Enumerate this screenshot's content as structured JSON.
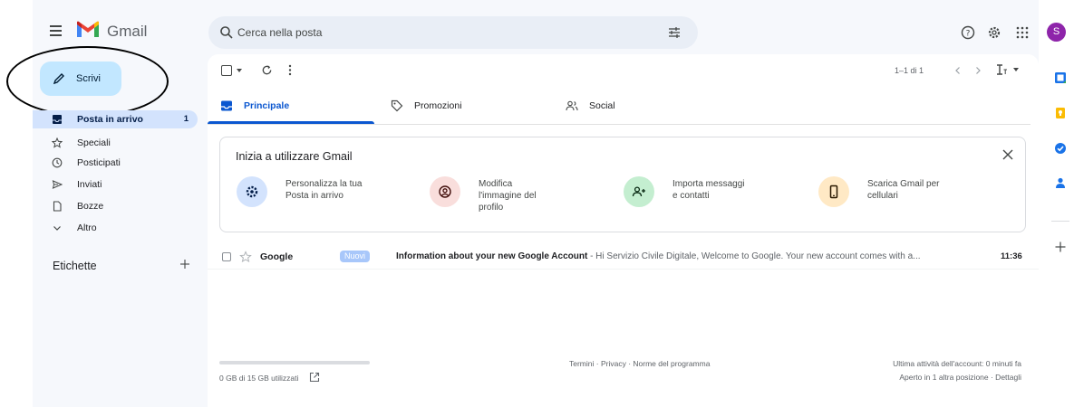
{
  "header": {
    "app_name": "Gmail",
    "search_placeholder": "Cerca nella posta",
    "avatar_initial": "S"
  },
  "compose": {
    "label": "Scrivi"
  },
  "nav": {
    "items": [
      {
        "label": "Posta in arrivo",
        "count": "1",
        "icon": "inbox-icon",
        "active": true
      },
      {
        "label": "Speciali",
        "icon": "star-icon"
      },
      {
        "label": "Posticipati",
        "icon": "clock-icon"
      },
      {
        "label": "Inviati",
        "icon": "send-icon"
      },
      {
        "label": "Bozze",
        "icon": "draft-icon"
      },
      {
        "label": "Altro",
        "icon": "chevron-down-icon"
      }
    ],
    "labels_title": "Etichette"
  },
  "toolbar": {
    "pager": "1–1 di 1"
  },
  "tabs": [
    {
      "label": "Principale",
      "icon": "inbox-icon",
      "active": true
    },
    {
      "label": "Promozioni",
      "icon": "tag-icon"
    },
    {
      "label": "Social",
      "icon": "people-icon"
    }
  ],
  "setup": {
    "title": "Inizia a utilizzare Gmail",
    "steps": [
      {
        "label": "Personalizza la tua\nPosta in arrivo",
        "icon": "gear-icon",
        "color": "#d3e3fd"
      },
      {
        "label": "Modifica\nl'immagine del\nprofilo",
        "icon": "profile-icon",
        "color": "#f9dedc"
      },
      {
        "label": "Importa messaggi\ne contatti",
        "icon": "add-person-icon",
        "color": "#c4eed0"
      },
      {
        "label": "Scarica Gmail per\ncellulari",
        "icon": "phone-icon",
        "color": "#ffe9c5"
      }
    ]
  },
  "emails": [
    {
      "sender": "Google",
      "badge": "Nuovi",
      "subject": "Information about your new Google Account",
      "snippet": " - Hi Servizio Civile Digitale, Welcome to Google. Your new account comes with a...",
      "time": "11:36"
    }
  ],
  "footer": {
    "storage": "0 GB di 15 GB utilizzati",
    "storage_fraction": 0,
    "links": [
      "Termini",
      "Privacy",
      "Norme del programma"
    ],
    "separator": " · ",
    "activity": "Ultima attività dell'account: 0 minuti fa",
    "other_location": "Aperto in 1 altra posizione · Dettagli"
  },
  "colors": {
    "accent": "#0b57d0",
    "compose_bg": "#c2e7ff",
    "nav_active_bg": "#d3e3fd",
    "avatar_bg": "#8e24aa"
  }
}
